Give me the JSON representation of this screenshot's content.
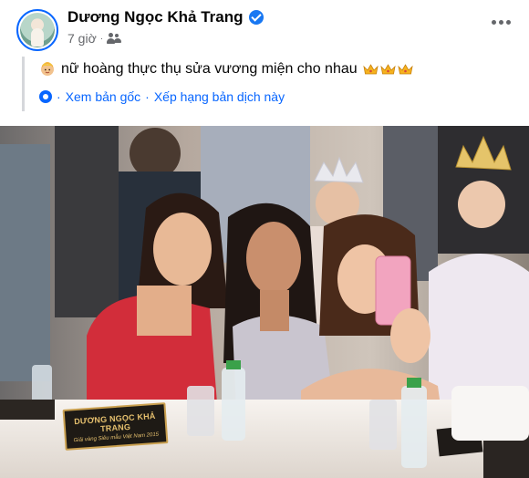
{
  "post": {
    "author_name": "Dương Ngọc Khả Trang",
    "time": "7 giờ",
    "separator": "·",
    "text": "nữ hoàng thực thụ sửa vương miện cho nhau",
    "emoji_prefix": "person-with-crown-emoji",
    "emoji_suffix": [
      "crown-emoji",
      "crown-emoji",
      "crown-emoji"
    ],
    "see_original": "Xem bản gốc",
    "rate_translation": "Xếp hạng bản dịch này",
    "translate_separator": "·"
  },
  "photo": {
    "nameplate_name": "DƯƠNG NGỌC KHẢ TRANG",
    "nameplate_subtitle": "Giải vàng Siêu mẫu Việt Nam 2015"
  },
  "colors": {
    "accent": "#0866ff",
    "verified": "#1877f2",
    "meta_text": "#65676b",
    "quote_bar": "#d5d7db"
  }
}
